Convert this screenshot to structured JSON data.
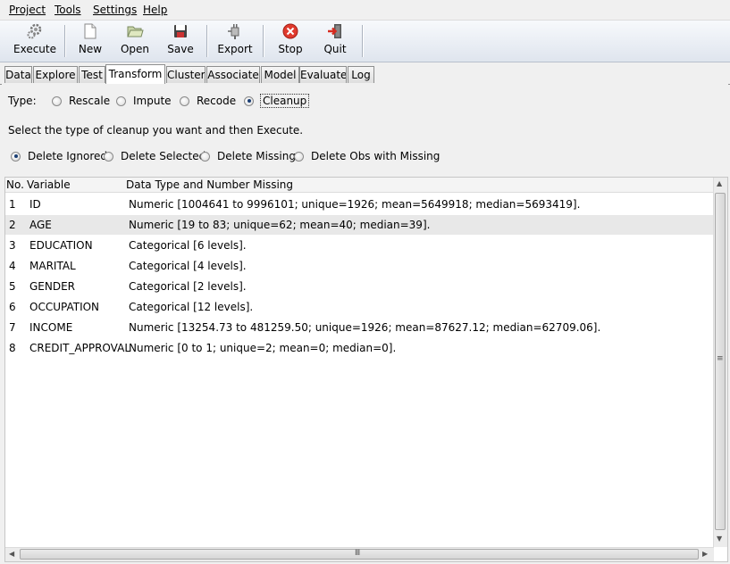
{
  "menu": [
    "Project",
    "Tools",
    "Settings",
    "Help"
  ],
  "toolbar": {
    "execute": "Execute",
    "new": "New",
    "open": "Open",
    "save": "Save",
    "export": "Export",
    "stop": "Stop",
    "quit": "Quit"
  },
  "tabs": [
    "Data",
    "Explore",
    "Test",
    "Transform",
    "Cluster",
    "Associate",
    "Model",
    "Evaluate",
    "Log"
  ],
  "active_tab": "Transform",
  "type_row": {
    "label": "Type:",
    "options": [
      "Rescale",
      "Impute",
      "Recode",
      "Cleanup"
    ],
    "selected": "Cleanup"
  },
  "instruction": "Select the type of cleanup you want and then Execute.",
  "cleanup_options": {
    "options": [
      "Delete Ignored",
      "Delete Selected",
      "Delete Missing",
      "Delete Obs with Missing"
    ],
    "selected": "Delete Ignored"
  },
  "table": {
    "headers": [
      "No.",
      "Variable",
      "Data Type and Number Missing"
    ],
    "rows": [
      {
        "no": "1",
        "variable": "ID",
        "info": "Numeric [1004641 to 9996101; unique=1926; mean=5649918; median=5693419]."
      },
      {
        "no": "2",
        "variable": "AGE",
        "info": "Numeric [19 to 83; unique=62; mean=40; median=39]."
      },
      {
        "no": "3",
        "variable": "EDUCATION",
        "info": "Categorical [6 levels]."
      },
      {
        "no": "4",
        "variable": "MARITAL",
        "info": "Categorical [4 levels]."
      },
      {
        "no": "5",
        "variable": "GENDER",
        "info": "Categorical [2 levels]."
      },
      {
        "no": "6",
        "variable": "OCCUPATION",
        "info": "Categorical [12 levels]."
      },
      {
        "no": "7",
        "variable": "INCOME",
        "info": "Numeric [13254.73 to 481259.50; unique=1926; mean=87627.12; median=62709.06]."
      },
      {
        "no": "8",
        "variable": "CREDIT_APPROVAL",
        "info": "Numeric [0 to 1; unique=2; mean=0; median=0]."
      }
    ],
    "selected_row": "2"
  }
}
